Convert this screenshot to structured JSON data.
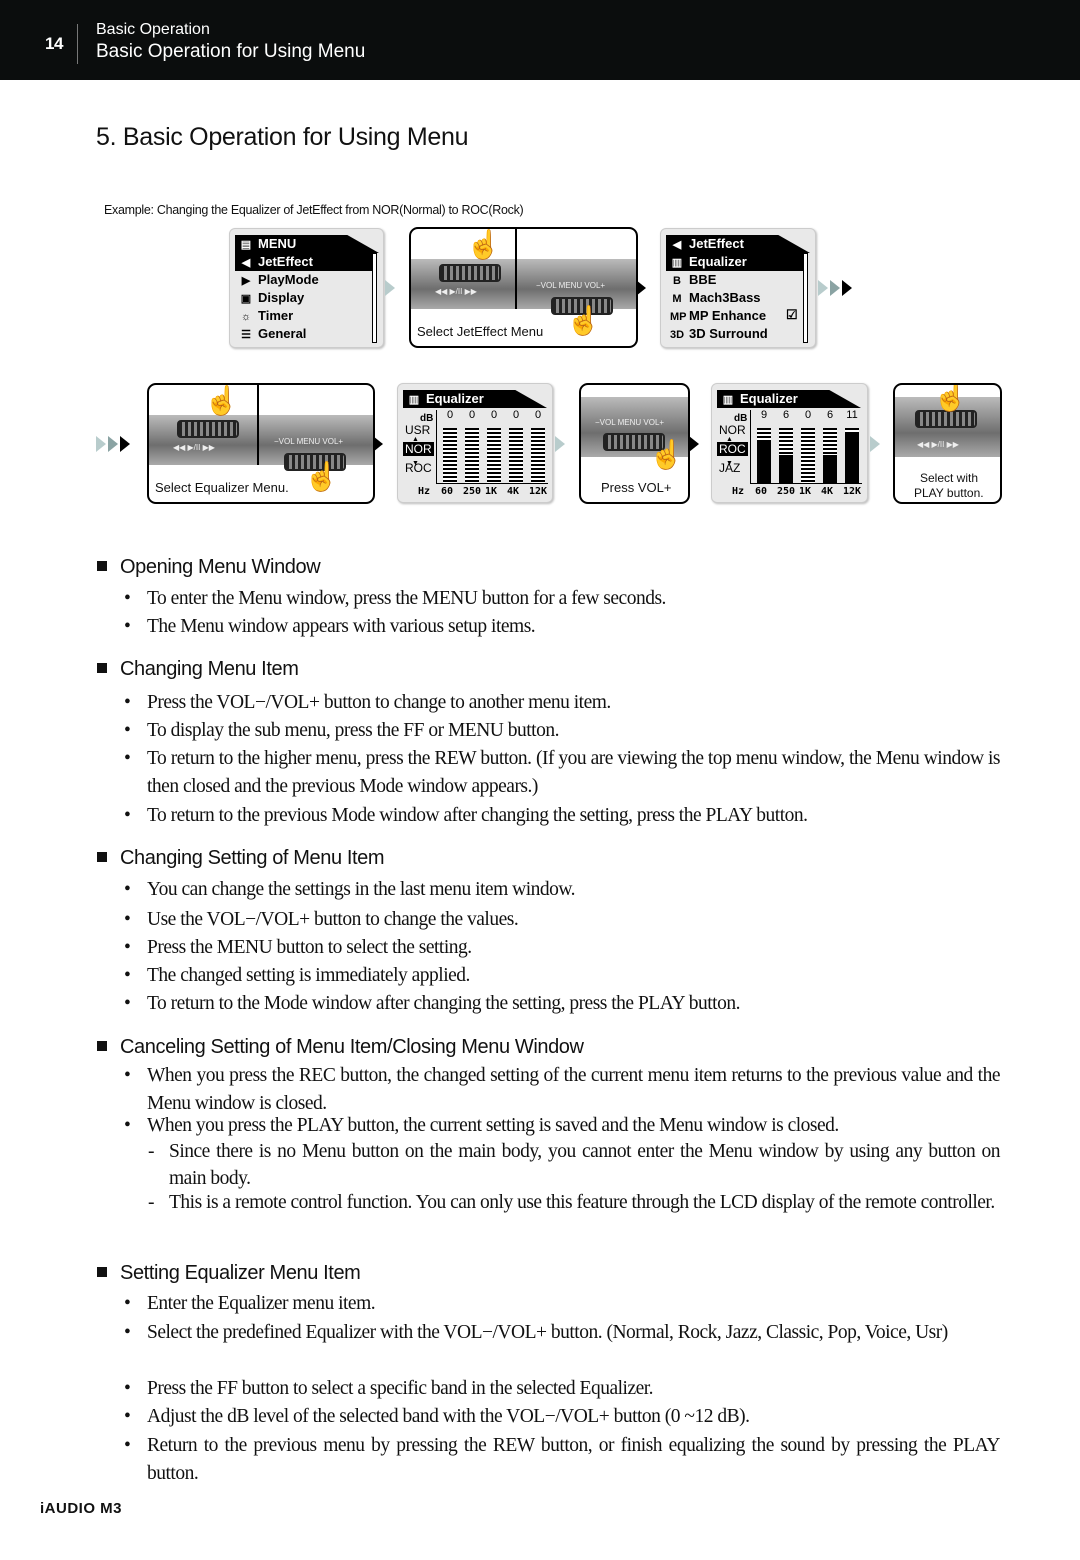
{
  "header": {
    "page_number": "14",
    "section": "Basic Operation",
    "title": "Basic Operation for Using Menu"
  },
  "heading": "5. Basic Operation for Using Menu",
  "example_caption": "Example: Changing the Equalizer of JetEffect from NOR(Normal) to ROC(Rock)",
  "steps": {
    "menu_panel": {
      "title": "MENU",
      "title_icon": "clipboard-icon",
      "items": [
        {
          "label": "JetEffect",
          "icon": "speaker-icon",
          "glyph": "◀",
          "selected": true
        },
        {
          "label": "PlayMode",
          "icon": "play-mode-icon",
          "glyph": "▶",
          "selected": false
        },
        {
          "label": "Display",
          "icon": "display-icon",
          "glyph": "▣",
          "selected": false
        },
        {
          "label": "Timer",
          "icon": "timer-icon",
          "glyph": "☼",
          "selected": false
        },
        {
          "label": "General",
          "icon": "general-icon",
          "glyph": "☰",
          "selected": false
        }
      ]
    },
    "device1": {
      "caption": "Select JetEffect Menu",
      "controls_left": "◀◀   ▶/II   ▶▶",
      "controls_right": "−VOL  MENU  VOL+"
    },
    "jeteffect_panel": {
      "title": "JetEffect",
      "items": [
        {
          "label": "Equalizer",
          "icon": "equalizer-icon",
          "glyph": "▥",
          "selected": true
        },
        {
          "label": "BBE",
          "icon": "bbe-icon",
          "glyph": "B",
          "selected": false
        },
        {
          "label": "Mach3Bass",
          "icon": "mach3bass-icon",
          "glyph": "M",
          "selected": false
        },
        {
          "label": "MP Enhance",
          "icon": "mp-enhance-icon",
          "glyph": "MP",
          "selected": false,
          "checked": true
        },
        {
          "label": "3D Surround",
          "icon": "3d-surround-icon",
          "glyph": "3D",
          "selected": false
        }
      ]
    },
    "device2": {
      "caption": "Select Equalizer Menu.",
      "controls_left": "◀◀   ▶/II   ▶▶",
      "controls_right": "−VOL  MENU  VOL+"
    },
    "eq1": {
      "title": "Equalizer",
      "db_label": "dB",
      "hz_label": "Hz",
      "presets": [
        "USR",
        "NOR",
        "ROC"
      ],
      "selected_preset": "NOR",
      "bands": [
        "60",
        "250",
        "1K",
        "4K",
        "12K"
      ],
      "values": [
        "0",
        "0",
        "0",
        "0",
        "0"
      ],
      "levels": [
        0,
        0,
        0,
        0,
        0
      ]
    },
    "device3": {
      "caption": "Press VOL+",
      "controls": "−VOL  MENU  VOL+"
    },
    "eq2": {
      "title": "Equalizer",
      "db_label": "dB",
      "hz_label": "Hz",
      "presets": [
        "NOR",
        "ROC",
        "JAZ"
      ],
      "selected_preset": "ROC",
      "bands": [
        "60",
        "250",
        "1K",
        "4K",
        "12K"
      ],
      "values": [
        "9",
        "6",
        "0",
        "6",
        "11"
      ],
      "levels": [
        9,
        6,
        0,
        6,
        11
      ],
      "max_db": 12
    },
    "device4": {
      "caption_line1": "Select with",
      "caption_line2": "PLAY button.",
      "controls": "◀◀   ▶/II   ▶▶"
    }
  },
  "sections": [
    {
      "heading": "Opening Menu Window",
      "bullets": [
        "To enter the Menu window, press the MENU button for a few seconds.",
        "The Menu window appears with various setup items."
      ]
    },
    {
      "heading": "Changing Menu Item",
      "bullets": [
        "Press the VOL−/VOL+ button to change to another menu item.",
        "To display the sub menu, press the FF or MENU button.",
        "To return to the higher menu, press the REW button. (If you are viewing the top menu window, the Menu window is then closed and the previous Mode window appears.)",
        "To return to the previous Mode window after changing the setting, press the PLAY button."
      ]
    },
    {
      "heading": "Changing Setting of Menu Item",
      "bullets": [
        "You can change the settings in the last menu item window.",
        "Use the VOL−/VOL+ button to change the values.",
        "Press the MENU button to select the setting.",
        "The changed setting is immediately applied.",
        "To return to the Mode window after changing the setting, press the PLAY button."
      ]
    },
    {
      "heading": "Canceling Setting of Menu Item/Closing Menu Window",
      "bullets": [
        "When you press the REC button, the changed setting of the current menu item returns to the previous value and the Menu window is closed.",
        "When you press the PLAY button, the current setting is saved and the Menu window is closed."
      ],
      "sub_bullets": [
        "Since there is no Menu button on the main body, you cannot enter the Menu window by using any button on main body.",
        "This is a remote control function. You can only use this feature through the LCD display of the remote controller."
      ]
    },
    {
      "heading": "Setting Equalizer Menu Item",
      "bullets": [
        "Enter the Equalizer menu item.",
        "Select the predefined Equalizer with the VOL−/VOL+ button. (Normal, Rock, Jazz, Classic, Pop, Voice, Usr)",
        "Press the FF button to select a specific band in the selected Equalizer.",
        "Adjust the dB level of the selected band with the VOL−/VOL+ button (0 ~12 dB).",
        "Return to the previous menu by pressing the REW button, or finish equalizing the sound by pressing the PLAY button."
      ]
    }
  ],
  "glyphs": {
    "bullet": "•",
    "dash": "-",
    "hand": "☝"
  },
  "footer": "iAUDIO M3"
}
